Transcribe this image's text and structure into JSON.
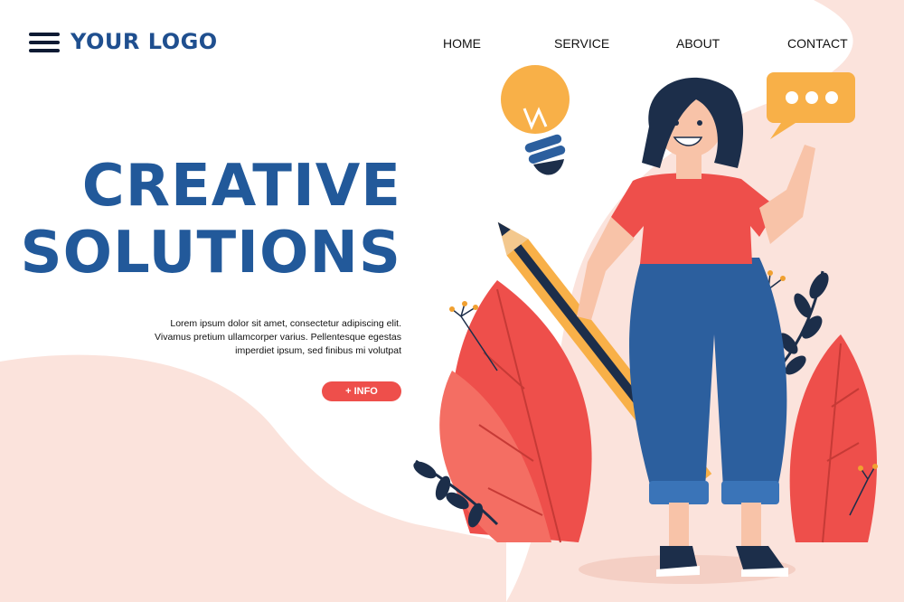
{
  "header": {
    "logo_text": "YOUR LOGO",
    "nav": [
      "HOME",
      "SERVICE",
      "ABOUT",
      "CONTACT"
    ]
  },
  "hero": {
    "title_line1": "CREATIVE",
    "title_line2": "SOLUTIONS",
    "body_lines": [
      "Lorem ipsum dolor sit amet, consectetur adipiscing elit.",
      "Vivamus pretium ullamcorper varius. Pellentesque egestas",
      "imperdiet ipsum, sed finibus mi volutpat"
    ],
    "cta_label": "+ INFO"
  },
  "colors": {
    "brand_blue": "#1f4f8f",
    "headline_blue": "#22599a",
    "cta_red": "#ee4f4b",
    "background_peach": "#fbe3dc"
  },
  "icons": [
    "hamburger-menu-icon",
    "light-bulb-icon",
    "chat-bubble-icon"
  ]
}
